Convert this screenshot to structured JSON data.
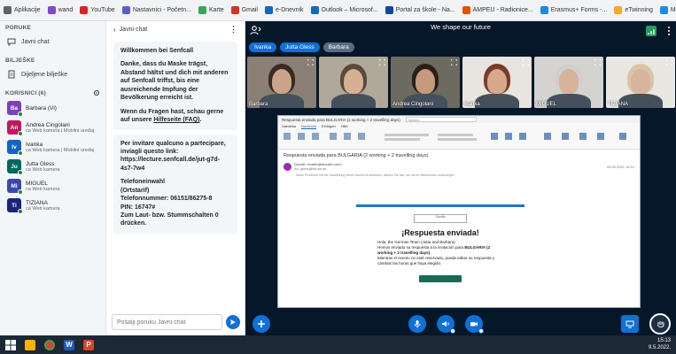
{
  "bookmarks": [
    {
      "label": "Aplikacije",
      "icon": "apps-grid-icon",
      "color": "#5f6368"
    },
    {
      "label": "wand",
      "icon": "wand-icon",
      "color": "#7b4ad1"
    },
    {
      "label": "YouTube",
      "icon": "youtube-icon",
      "color": "#e02020"
    },
    {
      "label": "Nastavnici - Početn...",
      "icon": "teams-icon",
      "color": "#5b5fc7"
    },
    {
      "label": "Karte",
      "icon": "maps-icon",
      "color": "#34a853"
    },
    {
      "label": "Gmail",
      "icon": "gmail-icon",
      "color": "#d93025"
    },
    {
      "label": "e-Dnevnik",
      "icon": "edn-icon",
      "color": "#1565c0"
    },
    {
      "label": "Outlook – Microsof...",
      "icon": "outlook-icon",
      "color": "#0f6cbd"
    },
    {
      "label": "Portal za škole - Na...",
      "icon": "portal-icon",
      "color": "#0d47a1"
    },
    {
      "label": "AMPEU - Radionice...",
      "icon": "ampeu-icon",
      "color": "#e65100"
    },
    {
      "label": "Erasmus+ Forms -...",
      "icon": "erasmus-icon",
      "color": "#1e88e5"
    },
    {
      "label": "eTwinning",
      "icon": "etwinning-icon",
      "color": "#f9a825"
    },
    {
      "label": "Mobility Tool",
      "icon": "mobility-icon",
      "color": "#1e88e5"
    }
  ],
  "leftnav": {
    "messages_title": "PORUKE",
    "public_chat": "Javni chat",
    "notes_title": "BILJEŠKE",
    "shared_notes": "Dijeljene bilješke",
    "users_title": "KORISNICI (6)",
    "users": [
      {
        "initials": "Ba",
        "name": "Barbara (Vi)",
        "status": "",
        "color": "#7b3fbf"
      },
      {
        "initials": "An",
        "name": "Andrea Cingolani",
        "status": "ca Web kamera | Mobilni uređaj",
        "color": "#c2185b"
      },
      {
        "initials": "Iv",
        "name": "Ivanka",
        "status": "ca Web kamera | Mobilni uređaj",
        "color": "#1565c0"
      },
      {
        "initials": "Ju",
        "name": "Jutta Gless",
        "status": "ca Web kamera",
        "color": "#00695c"
      },
      {
        "initials": "Mi",
        "name": "MIGUEL",
        "status": "ca Web kamera",
        "color": "#3949ab"
      },
      {
        "initials": "Ti",
        "name": "TIZIANA",
        "status": "ca Web kamera",
        "color": "#1a237e"
      }
    ]
  },
  "chat": {
    "title": "Javni chat",
    "welcome": {
      "heading": "Willkommen bei Senfcall",
      "p1": "Danke, dass du Maske trägst, Abstand hältst und dich mit anderen auf Senfcall triffst, bis eine ausreichende Impfung der Bevölkerung erreicht ist.",
      "p2_start": "Wenn du Fragen hast, schau gerne auf unsere ",
      "p2_link": "Hilfeseite (FAQ)",
      "p2_end": "."
    },
    "invite": {
      "p1": "Per invitare qualcuno a partecipare, inviagli questo link:",
      "link": "https://lecture.senfcall.de/jut-g7d-4s7-7w4",
      "heading": "Telefoneinwahl",
      "sub": "(Ortstarif)",
      "phone": "Telefonnummer: 06151/86275-8",
      "pin": "PIN: 16747#",
      "mute": "Zum Laut- bzw. Stummschalten 0 drücken."
    },
    "input_placeholder": "Pošalji poruku Javni chat"
  },
  "main": {
    "title": "We shape our future",
    "talking": [
      {
        "name": "Ivanka",
        "color": "#0f70d7"
      },
      {
        "name": "Jutta Gless",
        "color": "#0f70d7"
      },
      {
        "name": "Barbara",
        "color": "#5b6b80"
      }
    ],
    "videos": [
      {
        "name": "Barbara",
        "bg": "#8a7f74",
        "face": "#c9a48a",
        "hair": "#3a2a22"
      },
      {
        "name": "",
        "bg": "#b0a99a",
        "face": "#d7b093",
        "hair": "#5a4a3c"
      },
      {
        "name": "Andrea Cingolani",
        "bg": "#6d6a60",
        "face": "#c39a7c",
        "hair": "#2b1e17"
      },
      {
        "name": "Ivanka",
        "bg": "#e8e4df",
        "face": "#d6a98a",
        "hair": "#7a3b2b"
      },
      {
        "name": "MIGUEL",
        "bg": "#d5d3cf",
        "face": "#d7b39a",
        "hair": "#cfcfcf"
      },
      {
        "name": "TIZIANA",
        "bg": "#e9e7e1",
        "face": "#d8b49c",
        "hair": "#d9c5a5"
      }
    ]
  },
  "screen": {
    "search": "Iščemo",
    "tabs": [
      "Datoteka",
      "Nachricht",
      "Einfügen",
      "Hilfe"
    ],
    "subject": "Respuesta enviada para BULGARIA (2 working + 2 travelling days)",
    "sender_name": "Doodle <mailer@doodle.com>",
    "sender_to": "An: gless@ba-sw.de",
    "date": "09.05.2022 15:12",
    "body_hint": "Wenn Probleme mit der Darstellung dieser Nachricht bestehen, klicken Sie hier, um sie im Webbrowser anzuzeigen.",
    "card_logo": "Doodle",
    "card_title": "¡Respuesta enviada!",
    "card_greeting": "Hola, the German Team (Jutta and Barbara)",
    "card_line1_start": "Hemos enviado su respuesta a la invitación para ",
    "card_line1_bold": "BULGARIA (2 working + 2 travelling days)",
    "card_line1_end": ".",
    "card_line2": "Mientras el evento no esté reservado, puede editar su respuesta y cambiar las horas que haya elegido."
  },
  "taskbar": {
    "time": "15:13",
    "date": "9.5.2022."
  }
}
